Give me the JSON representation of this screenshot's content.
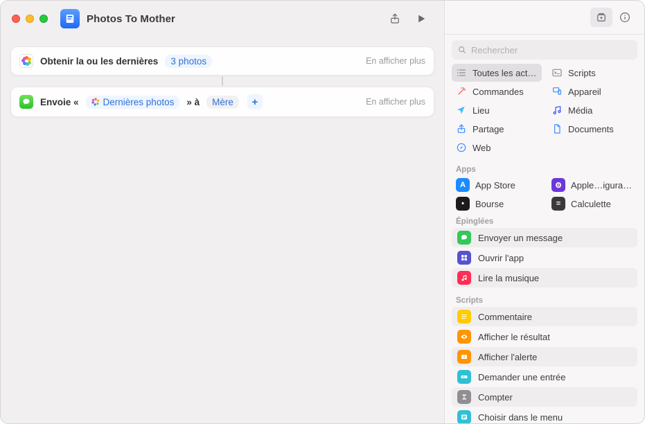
{
  "header": {
    "title": "Photos To Mother"
  },
  "actions": {
    "getPhotos": {
      "prefix": "Obtenir la ou les dernières",
      "countPill": "3 photos",
      "more": "En afficher plus"
    },
    "sendMessage": {
      "prefix": "Envoie «",
      "varPill": "Dernières photos",
      "mid": "» à",
      "recipientPill": "Mère",
      "more": "En afficher plus"
    }
  },
  "sidebar": {
    "searchPlaceholder": "Rechercher",
    "categories": [
      {
        "label": "Toutes les acti…",
        "color": "#8f8d93",
        "icon": "list"
      },
      {
        "label": "Scripts",
        "color": "#8f8d93",
        "icon": "terminal"
      },
      {
        "label": "Commandes",
        "color": "#ff453a",
        "icon": "wand"
      },
      {
        "label": "Appareil",
        "color": "#3d8bff",
        "icon": "device"
      },
      {
        "label": "Lieu",
        "color": "#3dbcff",
        "icon": "arrow"
      },
      {
        "label": "Média",
        "color": "#2f56ff",
        "icon": "music"
      },
      {
        "label": "Partage",
        "color": "#3d8bff",
        "icon": "share"
      },
      {
        "label": "Documents",
        "color": "#3d8bff",
        "icon": "doc"
      },
      {
        "label": "Web",
        "color": "#3d8bff",
        "icon": "safari"
      }
    ],
    "appsHeader": "Apps",
    "apps": [
      {
        "label": "App Store",
        "bg": "#1d8bff",
        "sym": "A"
      },
      {
        "label": "Apple…igurator",
        "bg": "#6b37d8",
        "sym": "⚙"
      },
      {
        "label": "Bourse",
        "bg": "#1c1c1e",
        "sym": "•"
      },
      {
        "label": "Calculette",
        "bg": "#3a3a3c",
        "sym": "="
      }
    ],
    "pinnedHeader": "Épinglées",
    "pinned": [
      {
        "label": "Envoyer un message",
        "bg": "#34c759",
        "icon": "message"
      },
      {
        "label": "Ouvrir l'app",
        "bg": "#5652d0",
        "icon": "grid"
      },
      {
        "label": "Lire la musique",
        "bg": "#ff2d55",
        "icon": "music"
      }
    ],
    "scriptsHeader": "Scripts",
    "scripts": [
      {
        "label": "Commentaire",
        "bg": "#ffcc00",
        "icon": "lines"
      },
      {
        "label": "Afficher le résultat",
        "bg": "#ff9500",
        "icon": "eye"
      },
      {
        "label": "Afficher l'alerte",
        "bg": "#ff9500",
        "icon": "alert"
      },
      {
        "label": "Demander une entrée",
        "bg": "#30c0d6",
        "icon": "input"
      },
      {
        "label": "Compter",
        "bg": "#8e8e93",
        "icon": "sigma"
      },
      {
        "label": "Choisir dans le menu",
        "bg": "#30c0d6",
        "icon": "menu"
      }
    ]
  }
}
